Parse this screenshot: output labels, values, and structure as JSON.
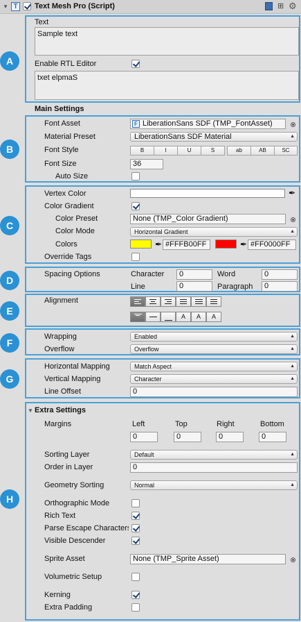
{
  "header": {
    "title": "Text Mesh Pro (Script)",
    "enabled": true,
    "icons": [
      "book-icon",
      "preset-icon",
      "gear-icon"
    ]
  },
  "badges": [
    "A",
    "B",
    "C",
    "D",
    "E",
    "F",
    "G",
    "H"
  ],
  "text_section": {
    "label": "Text",
    "value": "Sample text",
    "rtl_label": "Enable RTL Editor",
    "rtl_enabled": true,
    "rtl_value": "txet elpmaS"
  },
  "main_settings": {
    "heading": "Main Settings",
    "font_asset_label": "Font Asset",
    "font_asset_value": "LiberationSans SDF (TMP_FontAsset)",
    "material_preset_label": "Material Preset",
    "material_preset_value": "LiberationSans SDF Material",
    "font_style_label": "Font Style",
    "font_style_buttons": [
      "B",
      "I",
      "U",
      "S",
      "ab",
      "AB",
      "SC"
    ],
    "font_size_label": "Font Size",
    "font_size_value": "36",
    "auto_size_label": "Auto Size",
    "auto_size": false
  },
  "color": {
    "vertex_color_label": "Vertex Color",
    "vertex_color": "#FFFFFF",
    "color_gradient_label": "Color Gradient",
    "color_gradient": true,
    "color_preset_label": "Color Preset",
    "color_preset_value": "None (TMP_Color Gradient)",
    "color_mode_label": "Color Mode",
    "color_mode_value": "Horizontal Gradient",
    "colors_label": "Colors",
    "color1_hex": "#FFFB00FF",
    "color1": "#FFFB00",
    "color2_hex": "#FF0000FF",
    "color2": "#FF0000",
    "override_tags_label": "Override Tags",
    "override_tags": false
  },
  "spacing": {
    "label": "Spacing Options",
    "character_label": "Character",
    "character_value": "0",
    "word_label": "Word",
    "word_value": "0",
    "line_label": "Line",
    "line_value": "0",
    "paragraph_label": "Paragraph",
    "paragraph_value": "0"
  },
  "alignment": {
    "label": "Alignment",
    "horizontal": [
      "left",
      "center",
      "right",
      "justified",
      "flush",
      "geometry-center"
    ],
    "vertical": [
      "top",
      "middle",
      "bottom",
      "baseline",
      "midline",
      "capline"
    ],
    "selected_horizontal": "left",
    "selected_vertical": "top"
  },
  "wrapping": {
    "wrapping_label": "Wrapping",
    "wrapping_value": "Enabled",
    "overflow_label": "Overflow",
    "overflow_value": "Overflow"
  },
  "mapping": {
    "horizontal_label": "Horizontal Mapping",
    "horizontal_value": "Match Aspect",
    "vertical_label": "Vertical Mapping",
    "vertical_value": "Character",
    "line_offset_label": "Line Offset",
    "line_offset_value": "0"
  },
  "extra": {
    "heading": "Extra Settings",
    "margins_label": "Margins",
    "margin_headers": [
      "Left",
      "Top",
      "Right",
      "Bottom"
    ],
    "margin_values": [
      "0",
      "0",
      "0",
      "0"
    ],
    "sorting_layer_label": "Sorting Layer",
    "sorting_layer_value": "Default",
    "order_in_layer_label": "Order in Layer",
    "order_in_layer_value": "0",
    "geometry_sorting_label": "Geometry Sorting",
    "geometry_sorting_value": "Normal",
    "orthographic_label": "Orthographic Mode",
    "orthographic": false,
    "rich_text_label": "Rich Text",
    "rich_text": true,
    "parse_escape_label": "Parse Escape Characters",
    "parse_escape": true,
    "visible_descender_label": "Visible Descender",
    "visible_descender": true,
    "sprite_asset_label": "Sprite Asset",
    "sprite_asset_value": "None (TMP_Sprite Asset)",
    "volumetric_label": "Volumetric Setup",
    "volumetric": false,
    "kerning_label": "Kerning",
    "kerning": true,
    "extra_padding_label": "Extra Padding",
    "extra_padding": false
  }
}
